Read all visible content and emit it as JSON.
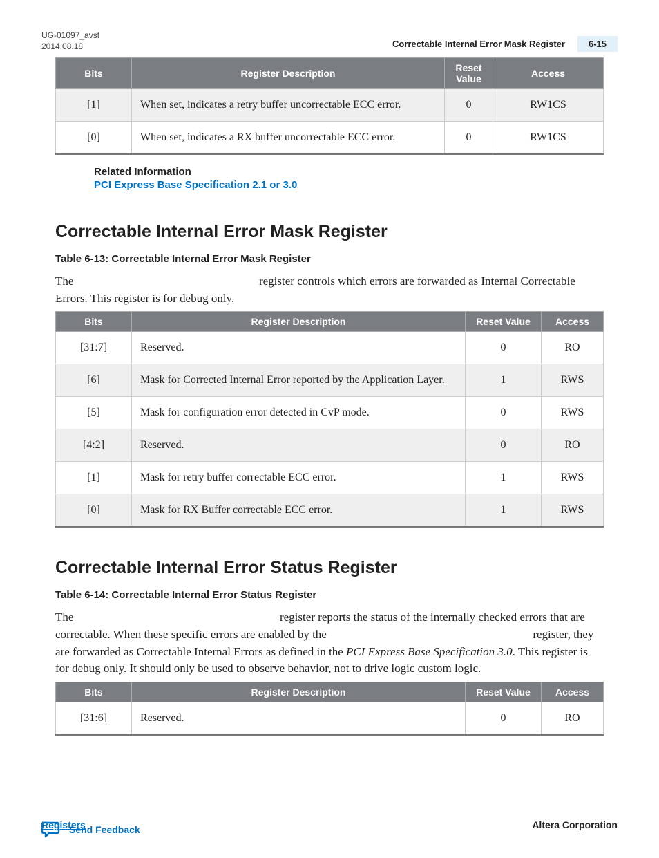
{
  "header": {
    "doc_id": "UG-01097_avst",
    "date": "2014.08.18",
    "title": "Correctable Internal Error Mask Register",
    "page": "6-15"
  },
  "table1": {
    "cols": [
      "Bits",
      "Register Description",
      "Reset Value",
      "Access"
    ],
    "rows": [
      {
        "bits": "[1]",
        "desc": "When set, indicates a retry buffer uncorrectable ECC error.",
        "rv": "0",
        "acc": "RW1CS"
      },
      {
        "bits": "[0]",
        "desc": "When set, indicates a RX buffer uncorrectable ECC error.",
        "rv": "0",
        "acc": "RW1CS"
      }
    ]
  },
  "related": {
    "label": "Related Information",
    "link": "PCI Express Base Specification 2.1 or 3.0"
  },
  "section1": {
    "heading": "Correctable Internal Error Mask Register",
    "caption": "Table 6-13: Correctable Internal Error Mask Register",
    "para_a": "The",
    "para_b": "register controls which errors are forwarded as Internal Correctable Errors. This register is for debug only."
  },
  "table2": {
    "cols": [
      "Bits",
      "Register Description",
      "Reset Value",
      "Access"
    ],
    "rows": [
      {
        "bits": "[31:7]",
        "desc": "Reserved.",
        "rv": "0",
        "acc": "RO"
      },
      {
        "bits": "[6]",
        "desc": "Mask for Corrected Internal Error reported by the Application Layer.",
        "rv": "1",
        "acc": "RWS"
      },
      {
        "bits": "[5]",
        "desc": "Mask for configuration error detected in CvP mode.",
        "rv": "0",
        "acc": "RWS"
      },
      {
        "bits": "[4:2]",
        "desc": "Reserved.",
        "rv": "0",
        "acc": "RO"
      },
      {
        "bits": "[1]",
        "desc": "Mask for retry buffer correctable ECC error.",
        "rv": "1",
        "acc": "RWS"
      },
      {
        "bits": "[0]",
        "desc": "Mask for RX Buffer correctable ECC error.",
        "rv": "1",
        "acc": "RWS"
      }
    ]
  },
  "section2": {
    "heading": "Correctable Internal Error Status Register",
    "caption": "Table 6-14: Correctable Internal Error Status Register",
    "para_a": "The",
    "para_b": "register reports the status of the internally checked errors that are correctable. When these specific errors are enabled by the",
    "para_c": "register, they are forwarded as Correctable Internal Errors as defined in the ",
    "para_italic": "PCI Express Base Specification 3.0",
    "para_d": ". This register is for debug only. It should only be used to observe behavior, not to drive logic custom logic."
  },
  "table3": {
    "cols": [
      "Bits",
      "Register Description",
      "Reset Value",
      "Access"
    ],
    "rows": [
      {
        "bits": "[31:6]",
        "desc": "Reserved.",
        "rv": "0",
        "acc": "RO"
      }
    ]
  },
  "footer": {
    "left": "Registers",
    "right": "Altera Corporation",
    "feedback": "Send Feedback"
  }
}
